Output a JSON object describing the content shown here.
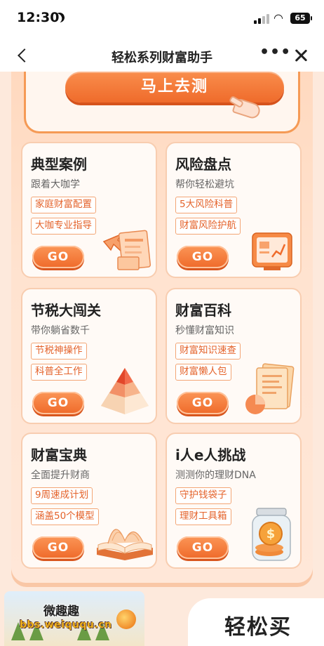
{
  "status_bar": {
    "time": "12:30",
    "battery": "65"
  },
  "nav": {
    "title": "轻松系列财富助手"
  },
  "top": {
    "cta_label": "马上去测"
  },
  "cards": [
    {
      "title": "典型案例",
      "subtitle": "跟着大咖学",
      "tags": [
        "家庭财富配置",
        "大咖专业指导"
      ],
      "go": "GO",
      "illustration": "documents-arrow-icon"
    },
    {
      "title": "风险盘点",
      "subtitle": "帮你轻松避坑",
      "tags": [
        "5大风险科普",
        "财富风险护航"
      ],
      "go": "GO",
      "illustration": "chart-board-icon"
    },
    {
      "title": "节税大闯关",
      "subtitle": "带你躺省数千",
      "tags": [
        "节税神操作",
        "科普全工作"
      ],
      "go": "GO",
      "illustration": "pyramid-icon"
    },
    {
      "title": "财富百科",
      "subtitle": "秒懂财富知识",
      "tags": [
        "财富知识速查",
        "财富懒人包"
      ],
      "go": "GO",
      "illustration": "pie-chart-papers-icon"
    },
    {
      "title": "财富宝典",
      "subtitle": "全面提升财商",
      "tags": [
        "9周速成计划",
        "涵盖50个模型"
      ],
      "go": "GO",
      "illustration": "open-book-icon"
    },
    {
      "title": "i人e人挑战",
      "subtitle": "测测你的理财DNA",
      "tags": [
        "守护钱袋子",
        "理财工具箱"
      ],
      "go": "GO",
      "illustration": "coin-jar-icon"
    }
  ],
  "footer": {
    "watermark_title": "微趣趣",
    "watermark_url": "bbs.weiququ.cn",
    "banner_title": "轻松买"
  },
  "colors": {
    "accent": "#ef6b2b",
    "panel": "#ffe3d0",
    "tag_text": "#e4622a"
  }
}
